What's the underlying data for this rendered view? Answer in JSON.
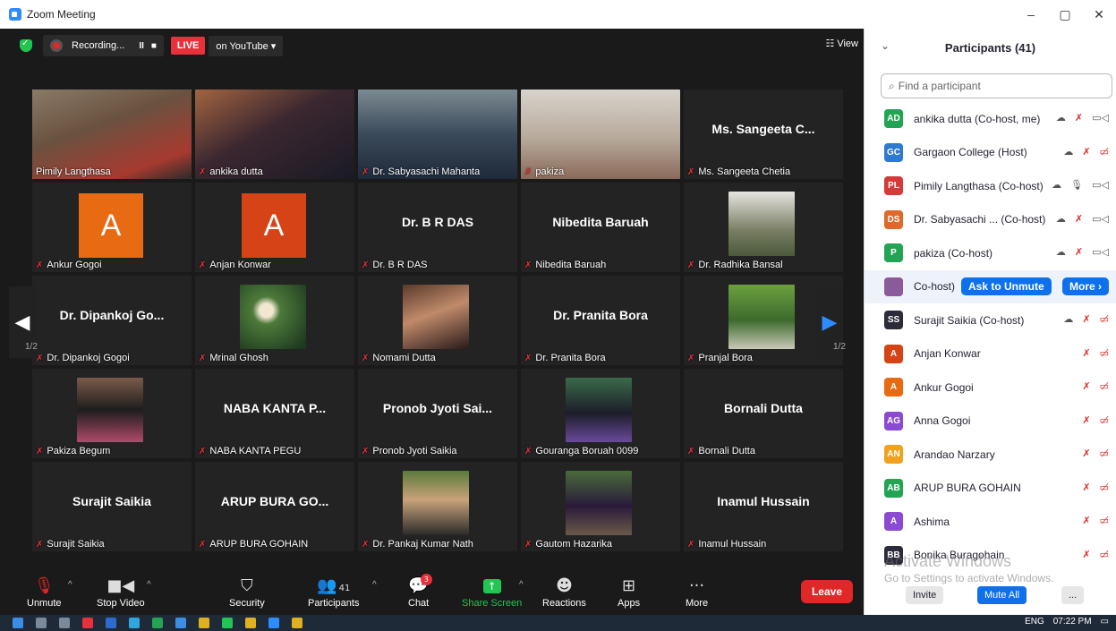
{
  "window": {
    "title": "Zoom Meeting",
    "min": "–",
    "max": "▢",
    "close": "✕"
  },
  "topbar": {
    "recording": "Recording...",
    "pause": "II",
    "stop": "■",
    "live": "LIVE",
    "stream": "on YouTube ▾",
    "view": "☷ View"
  },
  "tiles": [
    {
      "name": "Pimily Langthasa",
      "big": "",
      "type": "cam1",
      "active": true,
      "muted": false
    },
    {
      "name": "ankika dutta",
      "big": "",
      "type": "cam2",
      "muted": true
    },
    {
      "name": "Dr. Sabyasachi Mahanta",
      "big": "",
      "type": "cam3",
      "muted": true
    },
    {
      "name": "pakiza",
      "big": "",
      "type": "cam4",
      "muted": true
    },
    {
      "name": "Ms. Sangeeta Chetia",
      "big": "Ms. Sangeeta C...",
      "type": "text",
      "muted": true
    },
    {
      "name": "Ankur Gogoi",
      "big": "",
      "type": "avatar-a",
      "letter": "A",
      "muted": true
    },
    {
      "name": "Anjan Konwar",
      "big": "",
      "type": "avatar-a red",
      "letter": "A",
      "muted": true
    },
    {
      "name": "Dr. B R DAS",
      "big": "Dr. B R DAS",
      "type": "text",
      "muted": true
    },
    {
      "name": "Nibedita Baruah",
      "big": "Nibedita Baruah",
      "type": "text",
      "muted": true
    },
    {
      "name": "Dr. Radhika Bansal",
      "big": "",
      "type": "thumb t-radhika",
      "muted": true
    },
    {
      "name": "Dr. Dipankoj Gogoi",
      "big": "Dr. Dipankoj Go...",
      "type": "text",
      "muted": true
    },
    {
      "name": "Mrinal Ghosh",
      "big": "",
      "type": "thumb t-mrinal",
      "muted": true
    },
    {
      "name": "Nomami Dutta",
      "big": "",
      "type": "thumb t-nomami",
      "muted": true
    },
    {
      "name": "Dr. Pranita Bora",
      "big": "Dr. Pranita Bora",
      "type": "text",
      "muted": true
    },
    {
      "name": "Pranjal Bora",
      "big": "",
      "type": "thumb t-pranjal",
      "muted": true
    },
    {
      "name": "Pakiza Begum",
      "big": "",
      "type": "thumb t-pakiza",
      "muted": true
    },
    {
      "name": "NABA KANTA PEGU",
      "big": "NABA KANTA P...",
      "type": "text",
      "muted": true
    },
    {
      "name": "Pronob Jyoti Saikia",
      "big": "Pronob Jyoti Sai...",
      "type": "text",
      "muted": true
    },
    {
      "name": "Gouranga Boruah 0099",
      "big": "",
      "type": "thumb t-gouranga",
      "muted": true
    },
    {
      "name": "Bornali Dutta",
      "big": "Bornali Dutta",
      "type": "text",
      "muted": true
    },
    {
      "name": "Surajit Saikia",
      "big": "Surajit Saikia",
      "type": "text",
      "muted": true
    },
    {
      "name": "ARUP BURA GOHAIN",
      "big": "ARUP BURA GO...",
      "type": "text",
      "muted": true
    },
    {
      "name": "Dr. Pankaj Kumar Nath",
      "big": "",
      "type": "thumb t-pankaj",
      "muted": true
    },
    {
      "name": "Gautom Hazarika",
      "big": "",
      "type": "thumb t-gautom",
      "muted": true
    },
    {
      "name": "Inamul Hussain",
      "big": "Inamul Hussain",
      "type": "text",
      "muted": true
    }
  ],
  "nav": {
    "left": "◀",
    "right": "▶",
    "page_left": "1/2",
    "page_right": "1/2"
  },
  "toolbar": {
    "unmute": "Unmute",
    "stop_video": "Stop Video",
    "security": "Security",
    "participants": "Participants",
    "participants_count": "41",
    "chat": "Chat",
    "chat_badge": "3",
    "share_screen": "Share Screen",
    "reactions": "Reactions",
    "apps": "Apps",
    "more": "More",
    "leave": "Leave"
  },
  "panel": {
    "title": "Participants (41)",
    "search_placeholder": "Find a participant",
    "participants": [
      {
        "initials": "AD",
        "color": "#23a455",
        "name": "ankika dutta (Co-host, me)",
        "mic": "muted",
        "video": "on"
      },
      {
        "initials": "GC",
        "color": "#2f7ad1",
        "name": "Gargaon College (Host)",
        "mic": "muted",
        "video": "off"
      },
      {
        "initials": "PL",
        "color": "#d43a3a",
        "name": "Pimily Langthasa (Co-host)",
        "mic": "on",
        "video": "on"
      },
      {
        "initials": "DS",
        "color": "#e0682a",
        "name": "Dr. Sabyasachi ...  (Co-host)",
        "mic": "muted",
        "video": "on"
      },
      {
        "initials": "P",
        "color": "#23a455",
        "name": "pakiza (Co-host)",
        "mic": "muted",
        "video": "on"
      },
      {
        "initials": "",
        "color": "#8a5a9a",
        "name": "Co-host)",
        "mic": "",
        "video": "",
        "highlight": true
      },
      {
        "initials": "SS",
        "color": "#2b2b3a",
        "name": "Surajit Saikia (Co-host)",
        "mic": "muted",
        "video": "off"
      },
      {
        "initials": "A",
        "color": "#d64317",
        "name": "Anjan Konwar",
        "mic": "muted",
        "video": "off"
      },
      {
        "initials": "A",
        "color": "#e86a13",
        "name": "Ankur Gogoi",
        "mic": "muted",
        "video": "off"
      },
      {
        "initials": "AG",
        "color": "#8a4ad1",
        "name": "Anna Gogoi",
        "mic": "muted",
        "video": "off"
      },
      {
        "initials": "AN",
        "color": "#f0a21e",
        "name": "Arandao Narzary",
        "mic": "muted",
        "video": "off"
      },
      {
        "initials": "AB",
        "color": "#23a455",
        "name": "ARUP BURA GOHAIN",
        "mic": "muted",
        "video": "off"
      },
      {
        "initials": "A",
        "color": "#8a4ad1",
        "name": "Ashima",
        "mic": "muted",
        "video": "off"
      },
      {
        "initials": "BB",
        "color": "#2b2b3a",
        "name": "Bonika Buragohain",
        "mic": "muted",
        "video": "off"
      }
    ],
    "ask_to_unmute": "Ask to Unmute",
    "more": "More ›",
    "invite": "Invite",
    "mute_all": "Mute All",
    "dots": "...",
    "watermark_1": "Activate Windows",
    "watermark_2": "Go to Settings to activate Windows."
  },
  "taskbar": {
    "lang": "ENG",
    "time": "07:22 PM"
  }
}
